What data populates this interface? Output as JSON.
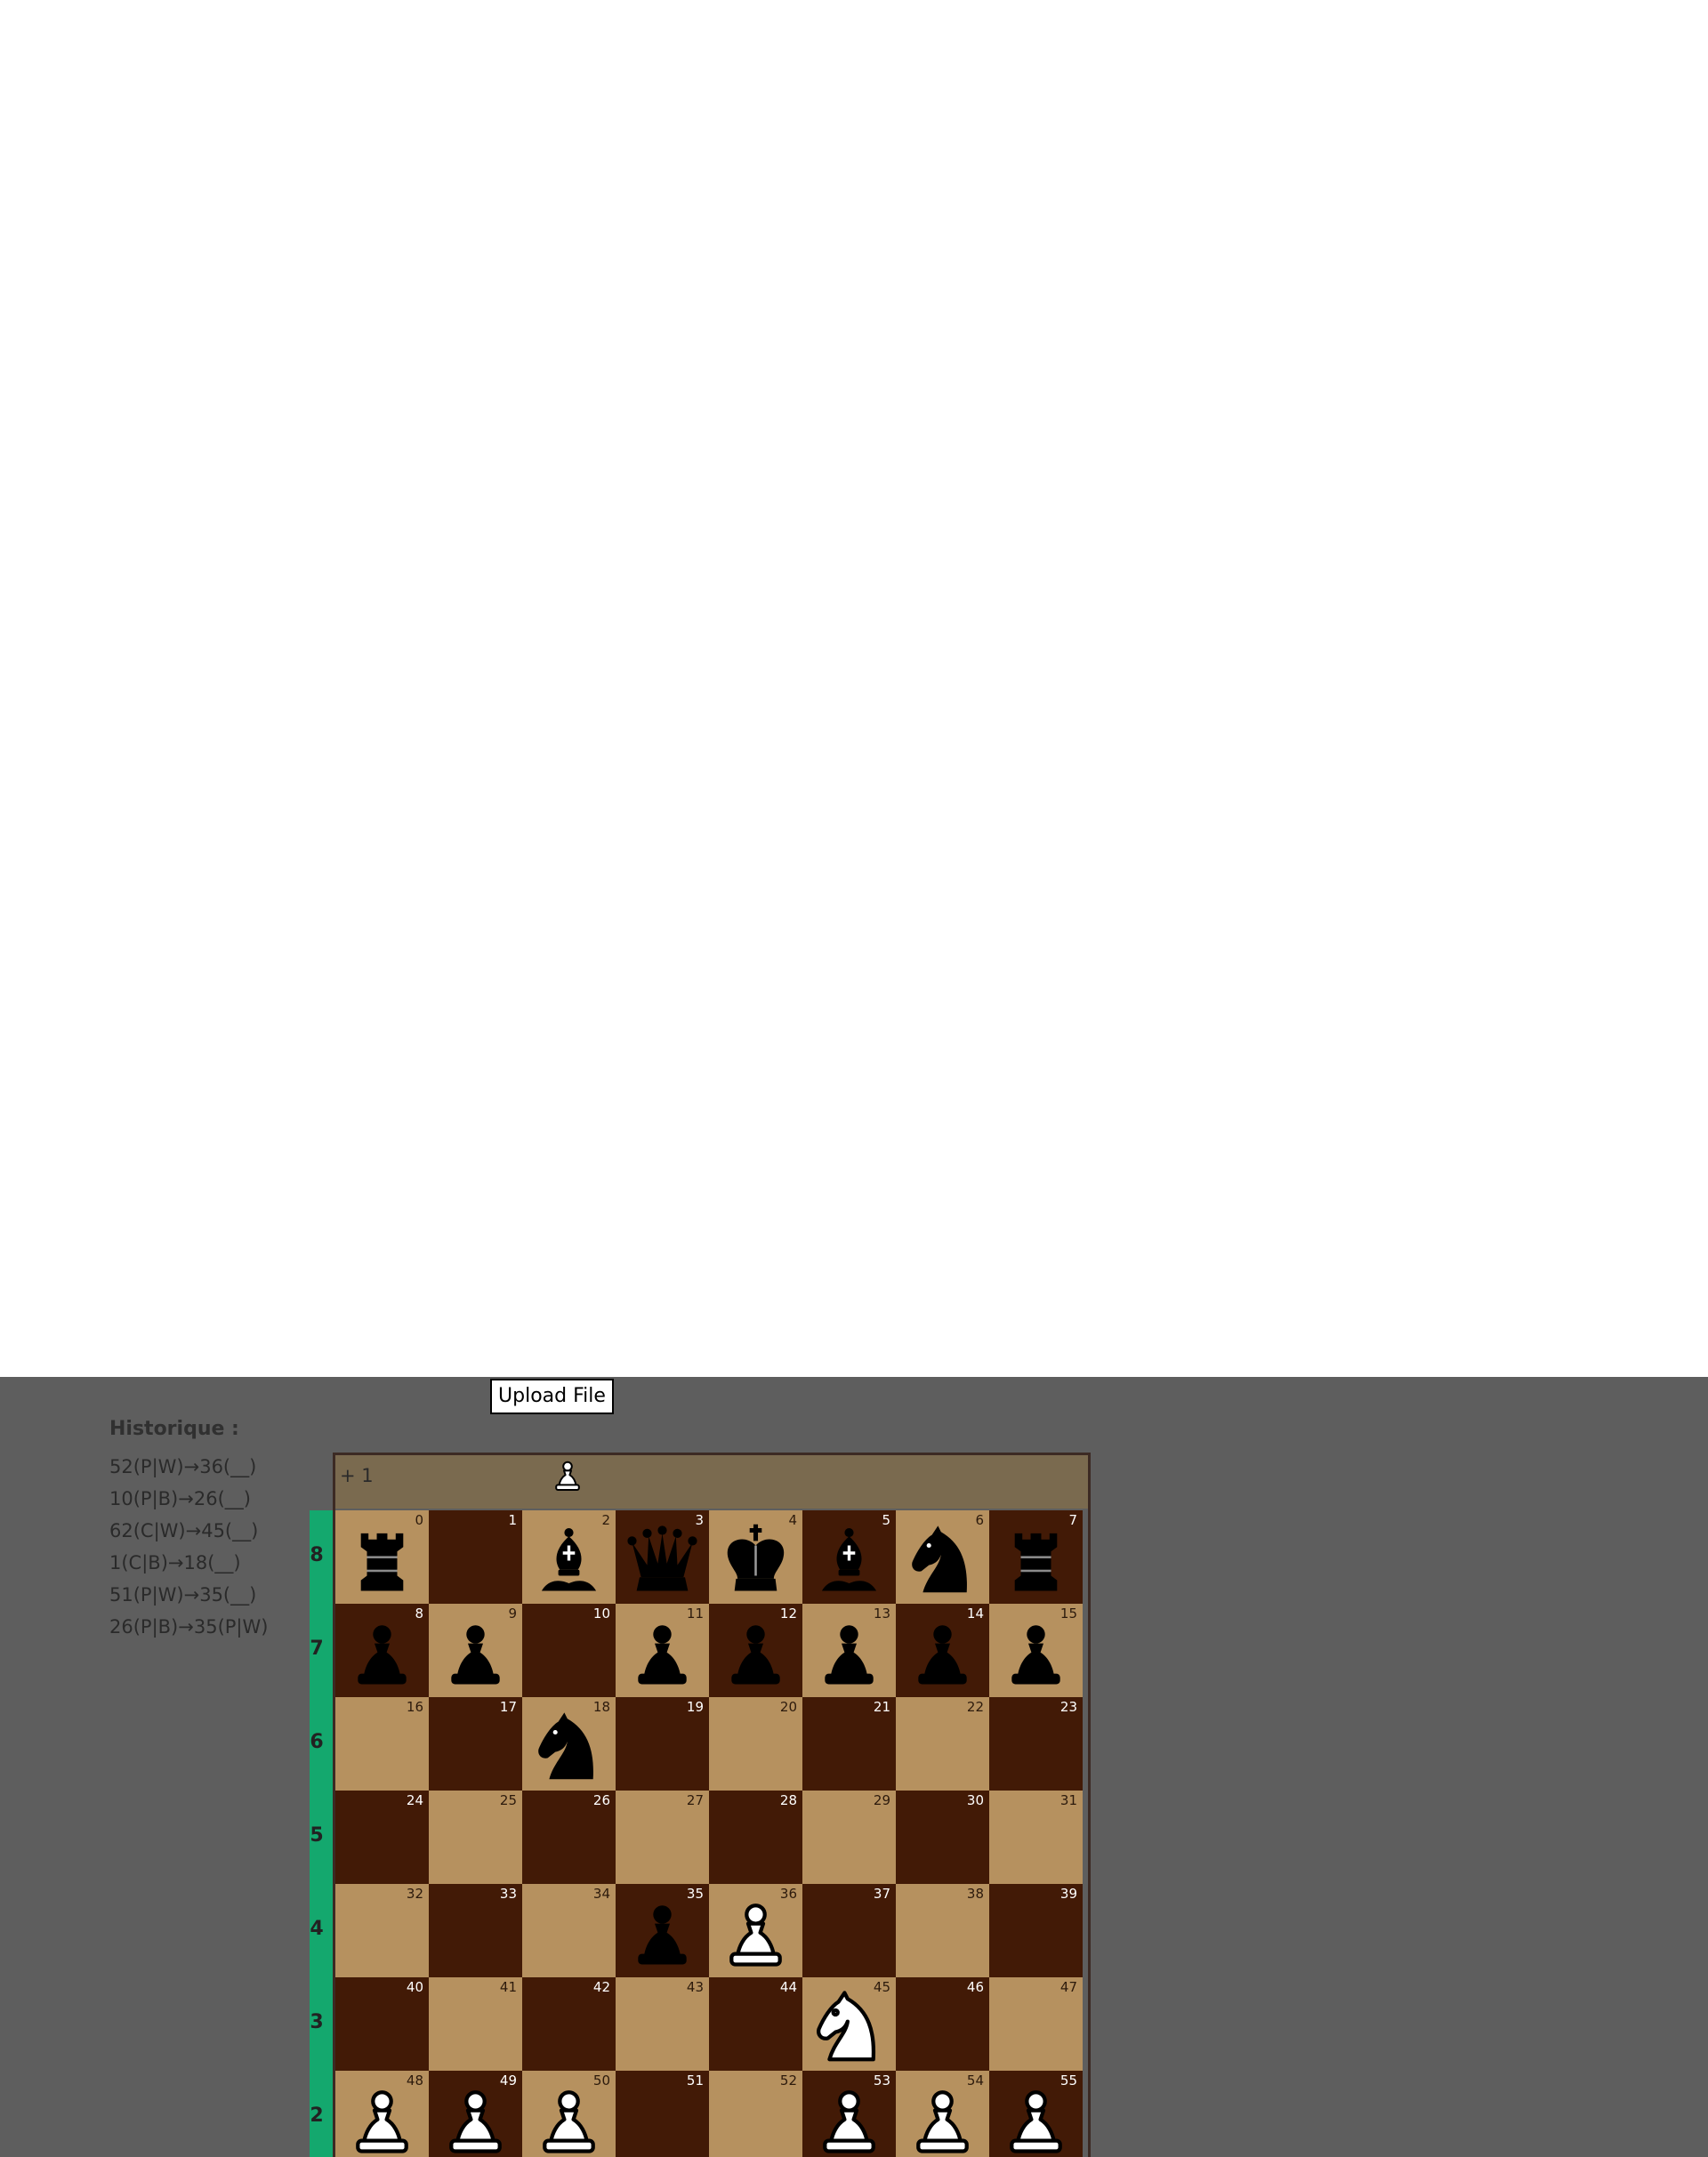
{
  "upload_button": {
    "label": "Upload File"
  },
  "history": {
    "title": "Historique :",
    "moves": [
      "52(P|W)→36(__)",
      "10(P|B)→26(__)",
      "62(C|W)→45(__)",
      "1(C|B)→18(__)",
      "51(P|W)→35(__)",
      "26(P|B)→35(P|W)"
    ]
  },
  "captured": {
    "count": "+ 1",
    "piece": "white-pawn"
  },
  "board": {
    "ranks": [
      "8",
      "7",
      "6",
      "5",
      "4",
      "3",
      "2"
    ],
    "light_color": "#b6915f",
    "dark_color": "#421a06",
    "rows": [
      [
        {
          "i": "0",
          "p": "rook",
          "c": "black"
        },
        {
          "i": "1",
          "p": "",
          "c": ""
        },
        {
          "i": "2",
          "p": "bishop",
          "c": "black"
        },
        {
          "i": "3",
          "p": "queen",
          "c": "black"
        },
        {
          "i": "4",
          "p": "king",
          "c": "black"
        },
        {
          "i": "5",
          "p": "bishop",
          "c": "black"
        },
        {
          "i": "6",
          "p": "knight",
          "c": "black"
        },
        {
          "i": "7",
          "p": "rook",
          "c": "black"
        }
      ],
      [
        {
          "i": "8",
          "p": "pawn",
          "c": "black"
        },
        {
          "i": "9",
          "p": "pawn",
          "c": "black"
        },
        {
          "i": "10",
          "p": "",
          "c": ""
        },
        {
          "i": "11",
          "p": "pawn",
          "c": "black"
        },
        {
          "i": "12",
          "p": "pawn",
          "c": "black"
        },
        {
          "i": "13",
          "p": "pawn",
          "c": "black"
        },
        {
          "i": "14",
          "p": "pawn",
          "c": "black"
        },
        {
          "i": "15",
          "p": "pawn",
          "c": "black"
        }
      ],
      [
        {
          "i": "16",
          "p": "",
          "c": ""
        },
        {
          "i": "17",
          "p": "",
          "c": ""
        },
        {
          "i": "18",
          "p": "knight",
          "c": "black"
        },
        {
          "i": "19",
          "p": "",
          "c": ""
        },
        {
          "i": "20",
          "p": "",
          "c": ""
        },
        {
          "i": "21",
          "p": "",
          "c": ""
        },
        {
          "i": "22",
          "p": "",
          "c": ""
        },
        {
          "i": "23",
          "p": "",
          "c": ""
        }
      ],
      [
        {
          "i": "24",
          "p": "",
          "c": ""
        },
        {
          "i": "25",
          "p": "",
          "c": ""
        },
        {
          "i": "26",
          "p": "",
          "c": ""
        },
        {
          "i": "27",
          "p": "",
          "c": ""
        },
        {
          "i": "28",
          "p": "",
          "c": ""
        },
        {
          "i": "29",
          "p": "",
          "c": ""
        },
        {
          "i": "30",
          "p": "",
          "c": ""
        },
        {
          "i": "31",
          "p": "",
          "c": ""
        }
      ],
      [
        {
          "i": "32",
          "p": "",
          "c": ""
        },
        {
          "i": "33",
          "p": "",
          "c": ""
        },
        {
          "i": "34",
          "p": "",
          "c": ""
        },
        {
          "i": "35",
          "p": "pawn",
          "c": "black"
        },
        {
          "i": "36",
          "p": "pawn",
          "c": "white"
        },
        {
          "i": "37",
          "p": "",
          "c": ""
        },
        {
          "i": "38",
          "p": "",
          "c": ""
        },
        {
          "i": "39",
          "p": "",
          "c": ""
        }
      ],
      [
        {
          "i": "40",
          "p": "",
          "c": ""
        },
        {
          "i": "41",
          "p": "",
          "c": ""
        },
        {
          "i": "42",
          "p": "",
          "c": ""
        },
        {
          "i": "43",
          "p": "",
          "c": ""
        },
        {
          "i": "44",
          "p": "",
          "c": ""
        },
        {
          "i": "45",
          "p": "knight",
          "c": "white"
        },
        {
          "i": "46",
          "p": "",
          "c": ""
        },
        {
          "i": "47",
          "p": "",
          "c": ""
        }
      ],
      [
        {
          "i": "48",
          "p": "pawn",
          "c": "white"
        },
        {
          "i": "49",
          "p": "pawn",
          "c": "white"
        },
        {
          "i": "50",
          "p": "pawn",
          "c": "white"
        },
        {
          "i": "51",
          "p": "",
          "c": ""
        },
        {
          "i": "52",
          "p": "",
          "c": ""
        },
        {
          "i": "53",
          "p": "pawn",
          "c": "white"
        },
        {
          "i": "54",
          "p": "pawn",
          "c": "white"
        },
        {
          "i": "55",
          "p": "pawn",
          "c": "white"
        }
      ]
    ]
  }
}
